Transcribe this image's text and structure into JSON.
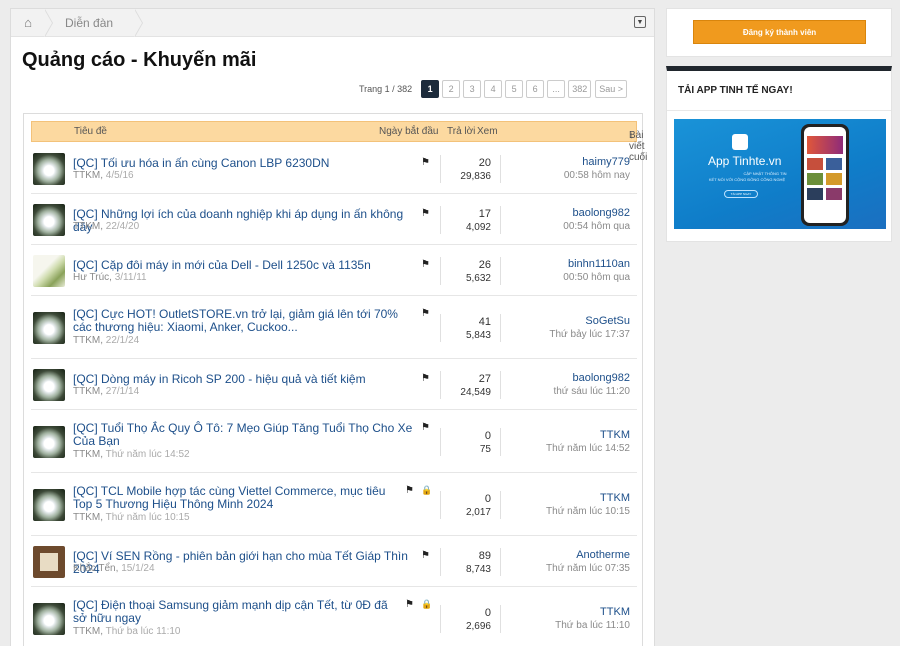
{
  "breadcrumb": {
    "home_icon": "home-icon",
    "forum": "Diễn đàn",
    "toggle_icon": "collapse-icon"
  },
  "page": {
    "title": "Quảng cáo - Khuyến mãi"
  },
  "pager": {
    "info": "Trang 1 / 382",
    "pages": [
      "1",
      "2",
      "3",
      "4",
      "5",
      "6",
      "...",
      "382"
    ],
    "active": "1",
    "next": "Sau >"
  },
  "columns": {
    "title": "Tiêu đề",
    "start_date": "Ngày bắt đầu",
    "replies": "Trả lời",
    "views": "Xem",
    "last_post": "Bài viết cuối",
    "sort_arrow": "↓"
  },
  "threads": [
    {
      "title": "[QC] Tối ưu hóa in ấn cùng Canon LBP 6230DN",
      "author": "TTKM",
      "date": "4/5/16",
      "replies": "20",
      "views": "29,836",
      "last_user": "haimy779",
      "last_time": "00:58 hôm nay",
      "locked": false,
      "avatar": "flower"
    },
    {
      "title": "[QC] Những lợi ích của doanh nghiệp khi áp dụng in ấn không dây",
      "author": "TTKM",
      "date": "22/4/20",
      "replies": "17",
      "views": "4,092",
      "last_user": "baolong982",
      "last_time": "00:54 hôm qua",
      "locked": false,
      "avatar": "flower"
    },
    {
      "title": "[QC] Cặp đôi máy in mới của Dell - Dell 1250c và 1135n",
      "author": "Hư Trúc",
      "date": "3/11/11",
      "replies": "26",
      "views": "5,632",
      "last_user": "binhn1110an",
      "last_time": "00:50 hôm qua",
      "locked": false,
      "avatar": "leaf"
    },
    {
      "title": "[QC] Cực HOT! OutletSTORE.vn trở lại, giảm giá lên tới 70% các thương hiệu: Xiaomi, Anker, Cuckoo...",
      "author": "TTKM",
      "date": "22/1/24",
      "replies": "41",
      "views": "5,843",
      "last_user": "SoGetSu",
      "last_time": "Thứ bảy lúc 17:37",
      "locked": false,
      "avatar": "flower"
    },
    {
      "title": "[QC] Dòng máy in Ricoh SP 200 - hiệu quả và tiết kiệm",
      "author": "TTKM",
      "date": "27/1/14",
      "replies": "27",
      "views": "24,549",
      "last_user": "baolong982",
      "last_time": "thứ sáu lúc 11:20",
      "locked": false,
      "avatar": "flower"
    },
    {
      "title": "[QC] Tuổi Thọ Ắc Quy Ô Tô: 7 Mẹo Giúp Tăng Tuổi Thọ Cho Xe Của Bạn",
      "author": "TTKM",
      "date": "Thứ năm lúc 14:52",
      "replies": "0",
      "views": "75",
      "last_user": "TTKM",
      "last_time": "Thứ năm lúc 14:52",
      "locked": false,
      "avatar": "flower"
    },
    {
      "title": "[QC] TCL Mobile hợp tác cùng Viettel Commerce, mục tiêu Top 5 Thương Hiệu Thông Minh 2024",
      "author": "TTKM",
      "date": "Thứ năm lúc 10:15",
      "replies": "0",
      "views": "2,017",
      "last_user": "TTKM",
      "last_time": "Thứ năm lúc 10:15",
      "locked": true,
      "avatar": "flower"
    },
    {
      "title": "[QC] Ví SEN Rồng - phiên bản giới hạn cho mùa Tết Giáp Thìn 2024",
      "author": "Khắc Tển",
      "date": "15/1/24",
      "replies": "89",
      "views": "8,743",
      "last_user": "Anotherme",
      "last_time": "Thứ năm lúc 07:35",
      "locked": false,
      "avatar": "wood"
    },
    {
      "title": "[QC] Điện thoại Samsung giảm mạnh dịp cận Tết, từ 0Đ đã sở hữu ngay",
      "author": "TTKM",
      "date": "Thứ ba lúc 11:10",
      "replies": "0",
      "views": "2,696",
      "last_user": "TTKM",
      "last_time": "Thứ ba lúc 11:10",
      "locked": true,
      "avatar": "flower"
    }
  ],
  "sidebar": {
    "register_label": "Đăng ký thành viên",
    "app_heading": "TẢI APP TINH TẾ NGAY!",
    "promo": {
      "app_name": "App Tinhte.vn",
      "line1": "CẬP NHẬT THÔNG TIN",
      "line2": "KẾT NỐI VỚI CỘNG ĐỒNG CÔNG NGHỆ",
      "download": "TẢI APP NGAY"
    }
  },
  "colors": {
    "header_bg": "#fcd9a0",
    "register_btn": "#f09a1e",
    "link": "#1d4f8a",
    "lock": "#e8b800"
  }
}
